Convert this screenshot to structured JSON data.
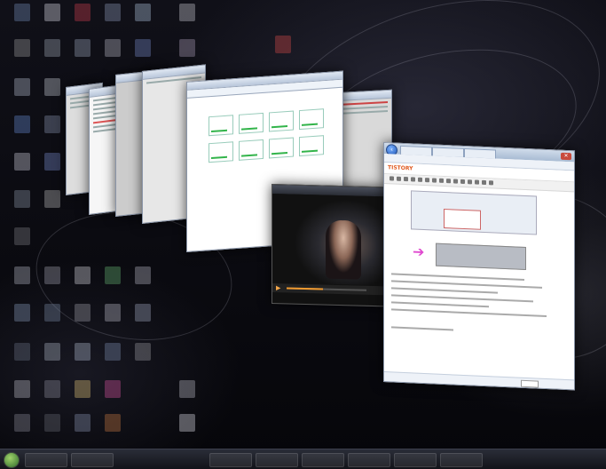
{
  "desktop": {
    "background": "#07070c",
    "accent": "#e05a20"
  },
  "taskbar": {
    "start_icon": "windows-orb-icon",
    "clock": ""
  },
  "blog_window": {
    "tabs": [
      "",
      "",
      ""
    ],
    "logo": "TISTORY",
    "close_icon": "close-icon",
    "back_icon": "back-arrow-icon"
  },
  "video_window": {
    "title": "",
    "caption": "",
    "progress": 0.45,
    "play_icon": "play-icon"
  }
}
